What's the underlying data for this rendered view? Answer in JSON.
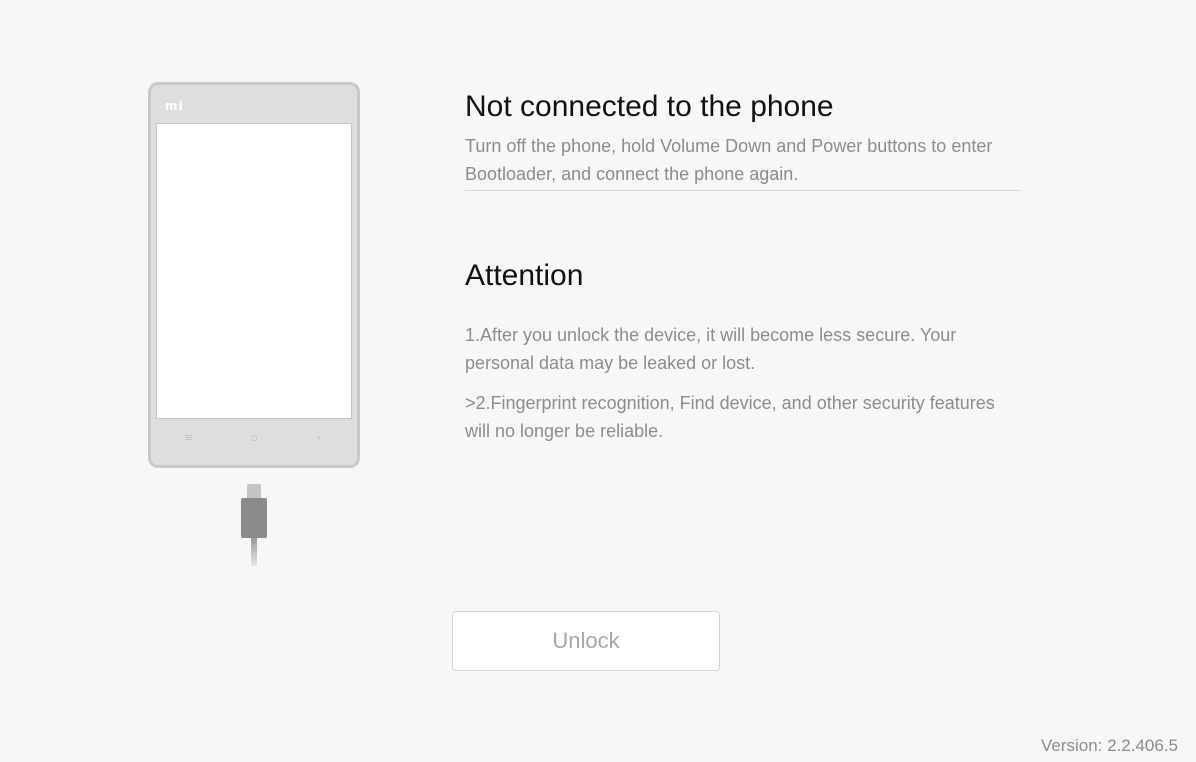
{
  "phone": {
    "logo_text": "mi",
    "nav_menu_glyph": "≡",
    "nav_home_glyph": "▫",
    "nav_back_glyph": "‹"
  },
  "status": {
    "title": "Not connected to the phone",
    "description": "Turn off the phone, hold Volume Down and Power buttons to enter Bootloader, and connect the phone again."
  },
  "attention": {
    "title": "Attention",
    "items": [
      "1.After you unlock the device, it will become less secure. Your personal data may be leaked or lost.",
      ">2.Fingerprint recognition, Find device, and other security features will no longer be reliable."
    ]
  },
  "unlock_button": {
    "label": "Unlock",
    "enabled": false
  },
  "footer": {
    "version": "Version: 2.2.406.5"
  },
  "colors": {
    "background": "#f7f7f7",
    "title_text": "#111111",
    "secondary_text": "#8c8c8c",
    "button_disabled_text": "#a6a6a6"
  }
}
